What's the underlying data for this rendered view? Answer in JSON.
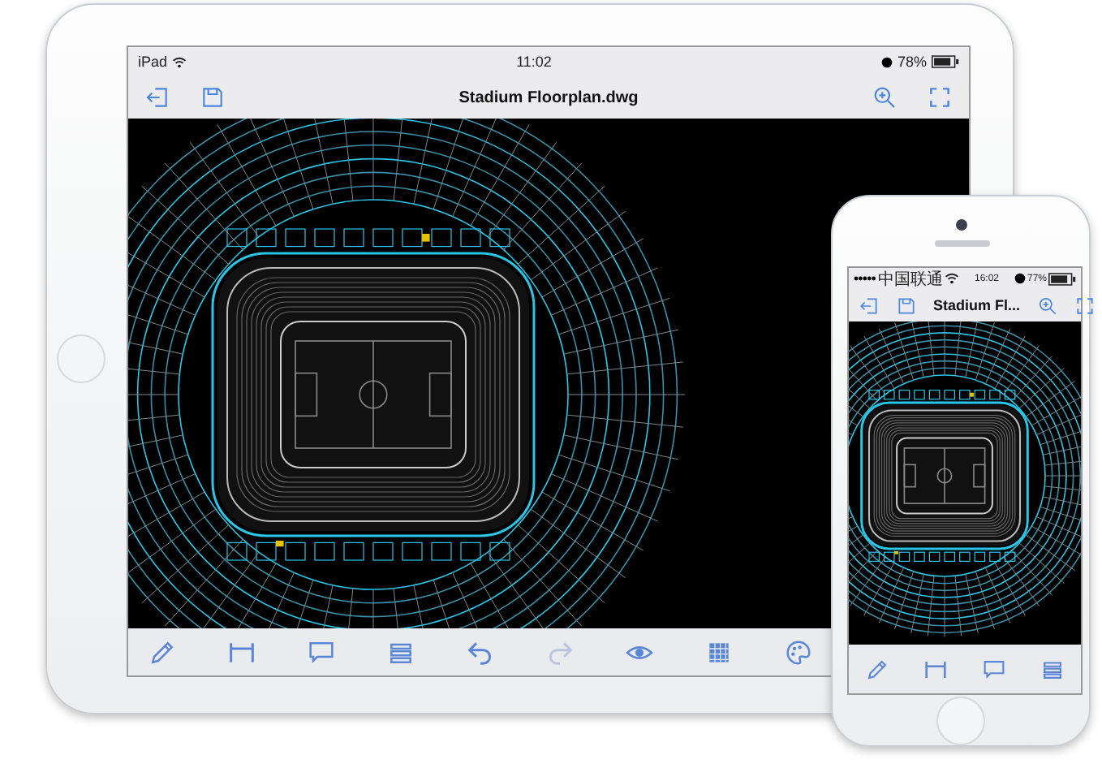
{
  "tablet": {
    "status_bar": {
      "carrier": "iPad",
      "time": "11:02",
      "battery": "78%"
    },
    "title": "Stadium Floorplan.dwg",
    "toolbar": [
      {
        "kind": "pencil",
        "disabled": false
      },
      {
        "kind": "dimension",
        "disabled": false
      },
      {
        "kind": "comment",
        "disabled": false
      },
      {
        "kind": "layers",
        "disabled": false
      },
      {
        "kind": "undo",
        "disabled": false
      },
      {
        "kind": "redo",
        "disabled": true
      },
      {
        "kind": "eye",
        "disabled": false
      },
      {
        "kind": "hatch",
        "disabled": false
      },
      {
        "kind": "palette",
        "disabled": false
      }
    ]
  },
  "phone": {
    "status_bar": {
      "carrier": "中国联通",
      "time": "16:02",
      "battery": "77%"
    },
    "title": "Stadium Fl...",
    "toolbar": [
      {
        "kind": "pencil",
        "disabled": false
      },
      {
        "kind": "dimension",
        "disabled": false
      },
      {
        "kind": "comment",
        "disabled": false
      },
      {
        "kind": "layers",
        "disabled": false
      }
    ]
  }
}
